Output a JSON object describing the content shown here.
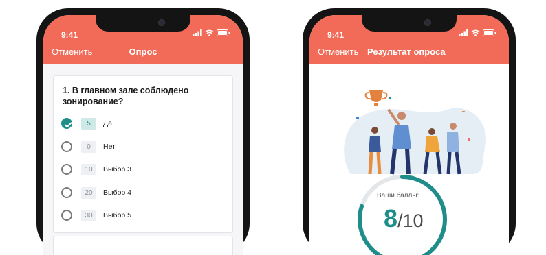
{
  "status_bar": {
    "time": "9:41"
  },
  "survey_screen": {
    "cancel_label": "Отменить",
    "title": "Опрос",
    "question": "1. В главном зале  соблюдено зонирование?",
    "options": [
      {
        "score": "5",
        "label": "Да",
        "selected": true
      },
      {
        "score": "0",
        "label": "Нет",
        "selected": false
      },
      {
        "score": "10",
        "label": "Выбор 3",
        "selected": false
      },
      {
        "score": "20",
        "label": "Выбор 4",
        "selected": false
      },
      {
        "score": "30",
        "label": "Выбор 5",
        "selected": false
      }
    ]
  },
  "result_screen": {
    "cancel_label": "Отменить",
    "title": "Результат опроса",
    "score_label": "Ваши баллы:",
    "score_value": "8",
    "score_total": "/10",
    "score_fraction": 0.8
  },
  "colors": {
    "header": "#f16b58",
    "accent": "#1f8d89",
    "phone_frame": "#141414"
  }
}
